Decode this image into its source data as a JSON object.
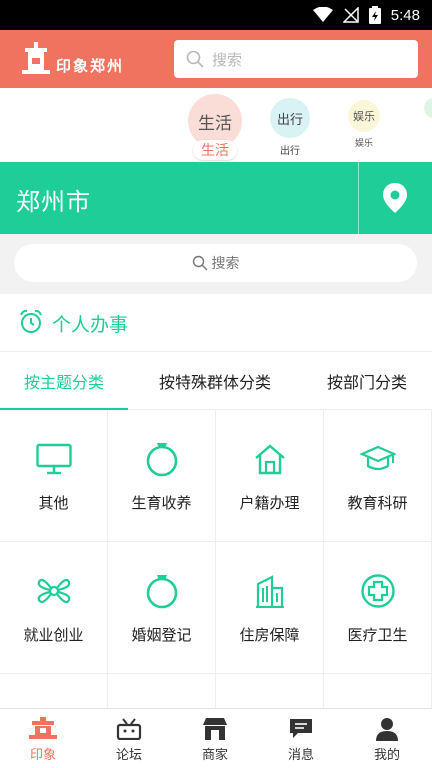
{
  "status_bar": {
    "time": "5:48"
  },
  "header": {
    "logo_text": "印象郑州",
    "search_placeholder": "搜索",
    "background": "#f0735f"
  },
  "categories": [
    {
      "label": "生活",
      "sub_label": "生活",
      "selected": true
    },
    {
      "label": "出行",
      "sub_label": "出行"
    },
    {
      "label": "娱乐",
      "sub_label": "娱乐"
    }
  ],
  "city": {
    "name": "郑州市",
    "icon": "location-pin-icon",
    "background": "#1ecd98"
  },
  "search": {
    "placeholder": "搜索"
  },
  "section": {
    "title": "个人办事",
    "icon": "alarm-clock-icon"
  },
  "tabs": [
    {
      "label": "按主题分类",
      "active": true
    },
    {
      "label": "按特殊群体分类"
    },
    {
      "label": "按部门分类"
    }
  ],
  "services": [
    {
      "label": "其他",
      "icon": "monitor-icon"
    },
    {
      "label": "生育收养",
      "icon": "ring-icon"
    },
    {
      "label": "户籍办理",
      "icon": "home-icon"
    },
    {
      "label": "教育科研",
      "icon": "graduation-cap-icon"
    },
    {
      "label": "就业创业",
      "icon": "fan-icon"
    },
    {
      "label": "婚姻登记",
      "icon": "ring-icon"
    },
    {
      "label": "住房保障",
      "icon": "buildings-icon"
    },
    {
      "label": "医疗卫生",
      "icon": "medical-cross-icon"
    }
  ],
  "bottom_nav": [
    {
      "label": "印象",
      "icon": "pagoda-icon",
      "active": true
    },
    {
      "label": "论坛",
      "icon": "forum-icon"
    },
    {
      "label": "商家",
      "icon": "shop-icon"
    },
    {
      "label": "消息",
      "icon": "message-icon"
    },
    {
      "label": "我的",
      "icon": "user-icon"
    }
  ],
  "colors": {
    "accent_green": "#1ecd98",
    "accent_coral": "#f0735f"
  }
}
